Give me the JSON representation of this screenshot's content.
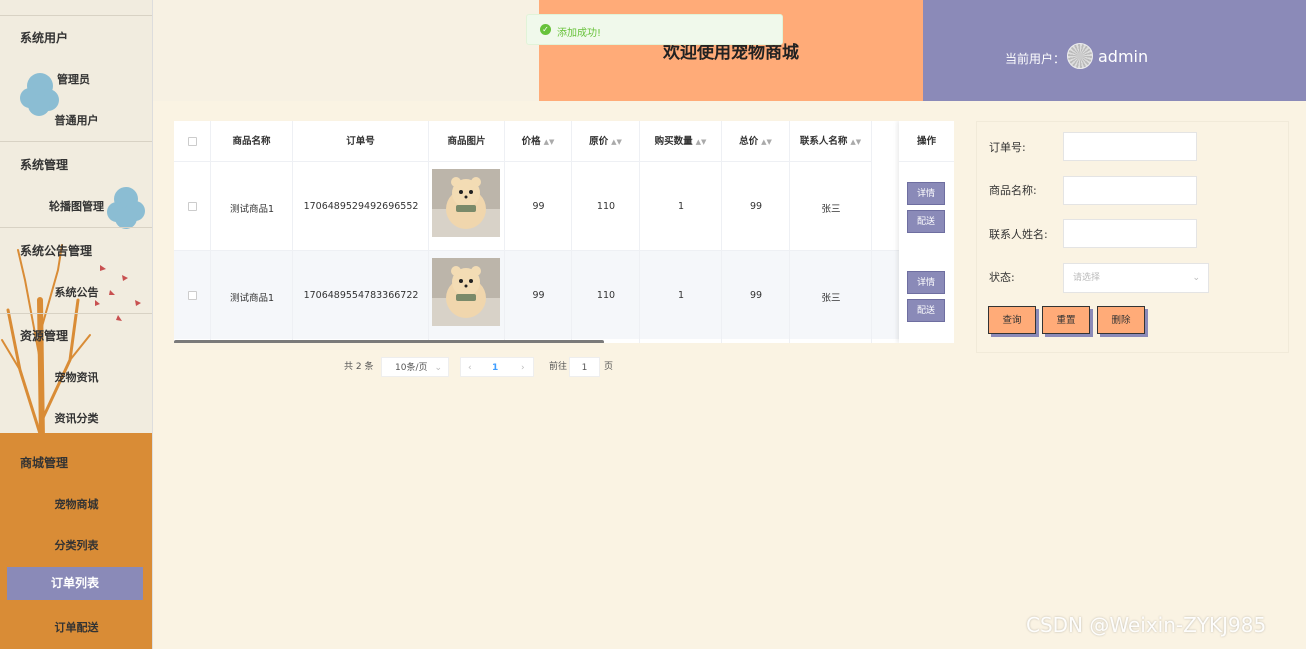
{
  "sidebar": {
    "groups": [
      {
        "title": "系统用户",
        "items": [
          "管理员",
          "普通用户"
        ]
      },
      {
        "title": "系统管理",
        "items": [
          "轮播图管理"
        ]
      },
      {
        "title": "系统公告管理",
        "items": [
          "系统公告"
        ]
      },
      {
        "title": "资源管理",
        "items": [
          "宠物资讯",
          "资讯分类"
        ]
      },
      {
        "title": "商城管理",
        "items": [
          "宠物商城",
          "分类列表",
          "订单列表",
          "订单配送"
        ]
      }
    ],
    "active_item": "订单列表"
  },
  "header": {
    "welcome": "欢迎使用宠物商城",
    "current_user_label": "当前用户：",
    "username": "admin"
  },
  "toast": {
    "text": "添加成功!",
    "type": "success"
  },
  "table": {
    "columns": [
      "商品名称",
      "订单号",
      "商品图片",
      "价格",
      "原价",
      "购买数量",
      "总价",
      "联系人名称",
      "操作"
    ],
    "rows": [
      {
        "name": "测试商品1",
        "order_no": "1706489529492696552",
        "price": "99",
        "original_price": "110",
        "quantity": "1",
        "total": "99",
        "contact": "张三"
      },
      {
        "name": "测试商品1",
        "order_no": "1706489554783366722",
        "price": "99",
        "original_price": "110",
        "quantity": "1",
        "total": "99",
        "contact": "张三"
      }
    ],
    "row_actions": [
      "详情",
      "配送"
    ]
  },
  "pagination": {
    "total_text": "共 2 条",
    "page_size": "10条/页",
    "current_page": "1",
    "goto_label": "前往",
    "goto_value": "1",
    "page_suffix": "页"
  },
  "search": {
    "order_no_label": "订单号:",
    "product_name_label": "商品名称:",
    "contact_label": "联系人姓名:",
    "status_label": "状态:",
    "status_placeholder": "请选择",
    "query_button": "查询",
    "reset_button": "重置",
    "delete_button": "删除"
  },
  "watermark": "CSDN @Weixin-ZYKJ985",
  "colors": {
    "accent_orange": "#ffab78",
    "accent_purple": "#8b8ab8",
    "sidebar_orange": "#d98c36",
    "page_bg": "#faf3e3",
    "success_green": "#67c23a"
  }
}
